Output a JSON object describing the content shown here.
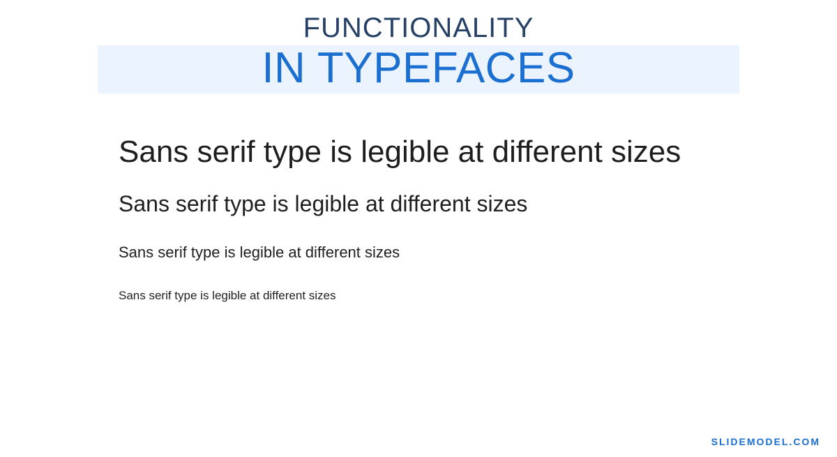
{
  "header": {
    "top": "FUNCTIONALITY",
    "main": "IN TYPEFACES"
  },
  "samples": {
    "line1": "Sans serif type is legible at different sizes",
    "line2": "Sans serif type is legible at different sizes",
    "line3": "Sans serif type is legible at different sizes",
    "line4": "Sans serif type is legible at different sizes"
  },
  "footer": {
    "brand": "SLIDEMODEL.COM"
  }
}
